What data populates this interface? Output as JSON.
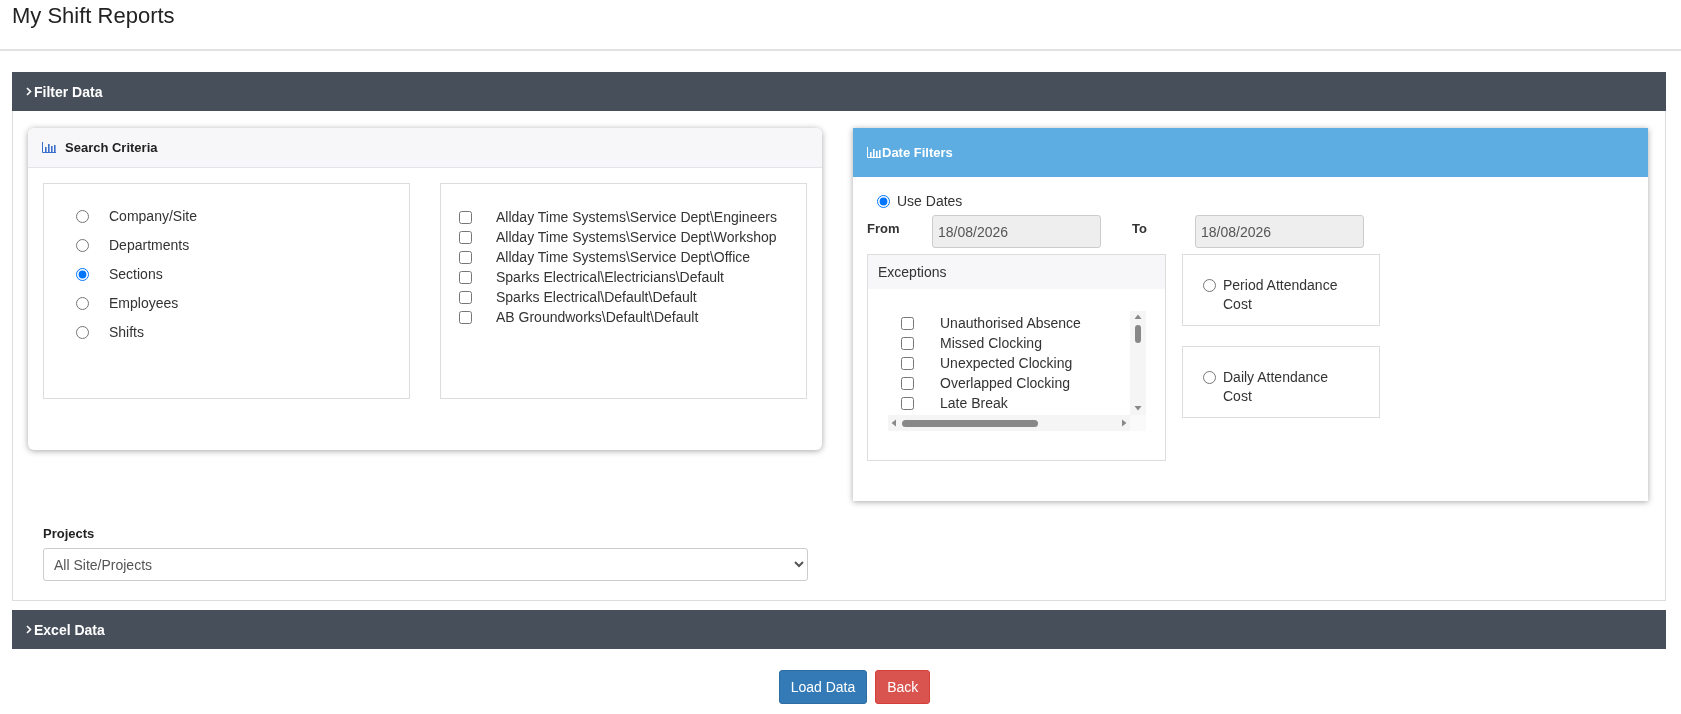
{
  "page_title": "My Shift Reports",
  "filter_section": {
    "title": "Filter Data"
  },
  "search_criteria": {
    "title": "Search Criteria",
    "options": [
      {
        "label": "Company/Site",
        "selected": false
      },
      {
        "label": "Departments",
        "selected": false
      },
      {
        "label": "Sections",
        "selected": true
      },
      {
        "label": "Employees",
        "selected": false
      },
      {
        "label": "Shifts",
        "selected": false
      }
    ],
    "items": [
      {
        "label": "Allday Time Systems\\Service Dept\\Engineers",
        "checked": false
      },
      {
        "label": "Allday Time Systems\\Service Dept\\Workshop",
        "checked": false
      },
      {
        "label": "Allday Time Systems\\Service Dept\\Office",
        "checked": false
      },
      {
        "label": "Sparks Electrical\\Electricians\\Default",
        "checked": false
      },
      {
        "label": "Sparks Electrical\\Default\\Default",
        "checked": false
      },
      {
        "label": "AB Groundworks\\Default\\Default",
        "checked": false
      }
    ]
  },
  "date_filters": {
    "title": "Date Filters",
    "use_dates": {
      "label": "Use Dates",
      "selected": true
    },
    "from_label": "From",
    "from_value": "18/08/2026",
    "to_label": "To",
    "to_value": "18/08/2026",
    "exceptions": {
      "title": "Exceptions",
      "items": [
        {
          "label": "Unauthorised Absence",
          "checked": false
        },
        {
          "label": "Missed Clocking",
          "checked": false
        },
        {
          "label": "Unexpected Clocking",
          "checked": false
        },
        {
          "label": "Overlapped Clocking",
          "checked": false
        },
        {
          "label": "Late Break",
          "checked": false
        }
      ]
    },
    "cost_options": [
      {
        "label": "Period Attendance Cost",
        "selected": false
      },
      {
        "label": "Daily Attendance Cost",
        "selected": false
      }
    ]
  },
  "projects": {
    "label": "Projects",
    "value": "All Site/Projects"
  },
  "excel_section": {
    "title": "Excel Data"
  },
  "buttons": [
    {
      "label": "Load Data",
      "kind": "primary"
    },
    {
      "label": "Back",
      "kind": "danger"
    }
  ]
}
